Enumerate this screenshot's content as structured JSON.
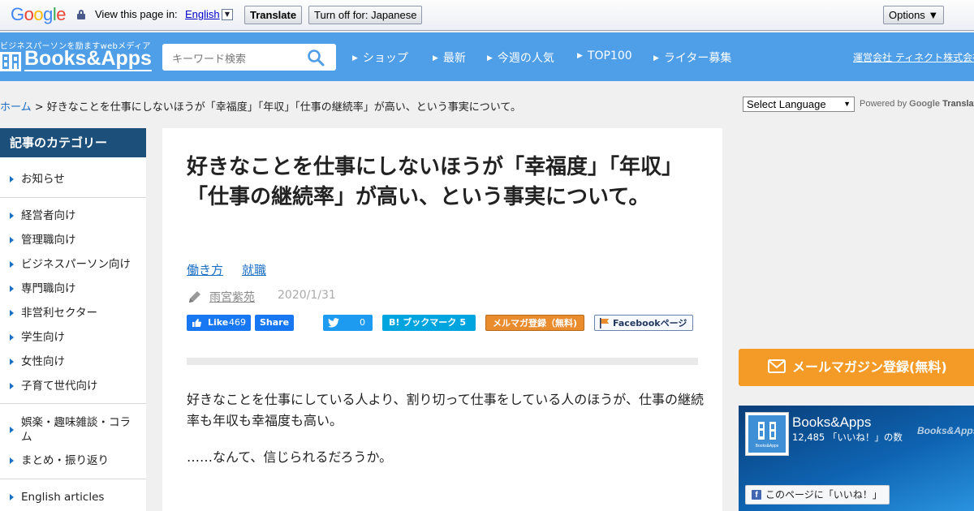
{
  "translate_bar": {
    "logo": "Google",
    "view_label": "View this page in:",
    "language": "English",
    "translate_button": "Translate",
    "turn_off_button": "Turn off for: Japanese",
    "options_button": "Options ▼"
  },
  "header": {
    "tagline": "ビジネスパーソンを励ますwebメディア",
    "logo_text": "Books&Apps",
    "search_placeholder": "キーワード検索",
    "nav": [
      "ショップ",
      "最新",
      "今週の人気",
      "TOP100",
      "ライター募集"
    ],
    "corp_link": "運営会社 ティネクト株式会社"
  },
  "breadcrumb": {
    "home": "ホーム",
    "separator": " > ",
    "current": "好きなことを仕事にしないほうが「幸福度」「年収」「仕事の継続率」が高い、という事実について。"
  },
  "language_select": {
    "value": "Select Language",
    "powered_by": "Powered by",
    "google": "Google",
    "translate": "Translate"
  },
  "sidebar": {
    "heading": "記事のカテゴリー",
    "items": [
      "お知らせ",
      "経営者向け",
      "管理職向け",
      "ビジネスパーソン向け",
      "専門職向け",
      "非営利セクター",
      "学生向け",
      "女性向け",
      "子育て世代向け",
      "娯楽・趣味雑談・コラム",
      "まとめ・振り返り",
      "English articles"
    ]
  },
  "article": {
    "title": "好きなことを仕事にしないほうが「幸福度」「年収」「仕事の継続率」が高い、という事実について。",
    "tags": [
      "働き方",
      "就職"
    ],
    "author": "雨宮紫苑",
    "date": "2020/1/31",
    "share": {
      "fb_like": "Like",
      "fb_like_count": "469",
      "fb_share": "Share",
      "tweet_count": "0",
      "hatena": "B! ブックマーク",
      "hatena_count": "5",
      "mailmag": "メルマガ登録（無料)",
      "facebook_page": "Facebookページ"
    },
    "paragraphs": [
      "好きなことを仕事にしている人より、割り切って仕事をしている人のほうが、仕事の継続率も年収も幸福度も高い。",
      "……なんて、信じられるだろうか。"
    ]
  },
  "right": {
    "mail_button": "メールマガジン登録(無料)",
    "fb_widget": {
      "name": "Books&Apps",
      "likes": "12,485 「いいね！」の数",
      "watermark": "Books&Apps",
      "like_button": "このページに「いいね！」"
    }
  },
  "colors": {
    "header_blue": "#4f9ee8",
    "sidebar_heading": "#1c4f7a",
    "link_blue": "#1a6fc4",
    "mail_orange": "#f39a27"
  }
}
